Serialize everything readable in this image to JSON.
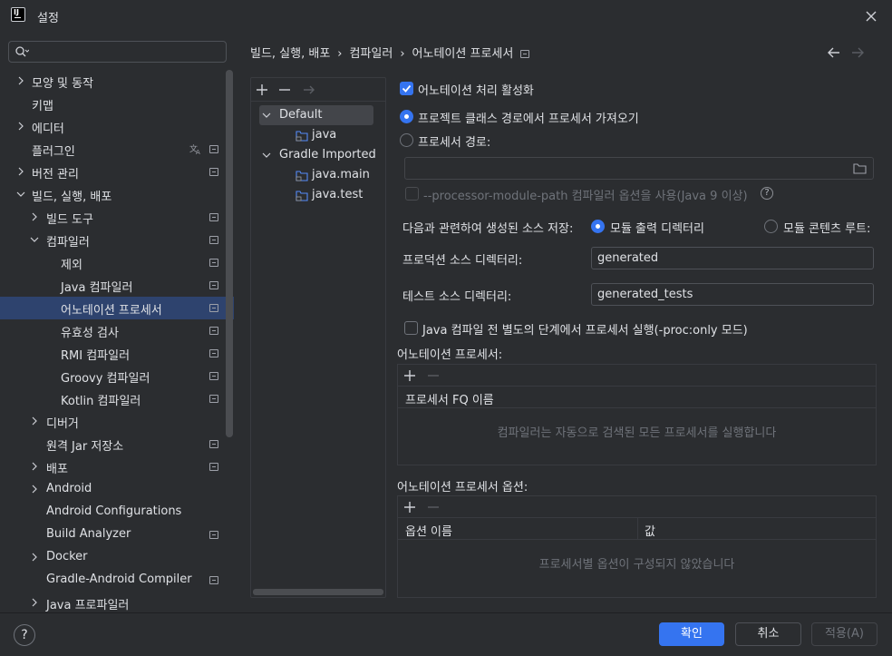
{
  "window": {
    "title": "설정",
    "logo_text": "IJ"
  },
  "search": {
    "placeholder": ""
  },
  "sidebar": {
    "items": [
      {
        "label": "모양 및 동작"
      },
      {
        "label": "키맵"
      },
      {
        "label": "에디터"
      },
      {
        "label": "플러그인"
      },
      {
        "label": "버전 관리"
      },
      {
        "label": "빌드, 실행, 배포"
      },
      {
        "label": "빌드 도구"
      },
      {
        "label": "컴파일러"
      },
      {
        "label": "제외"
      },
      {
        "label": "Java 컴파일러"
      },
      {
        "label": "어노테이션 프로세서"
      },
      {
        "label": "유효성 검사"
      },
      {
        "label": "RMI 컴파일러"
      },
      {
        "label": "Groovy 컴파일러"
      },
      {
        "label": "Kotlin 컴파일러"
      },
      {
        "label": "디버거"
      },
      {
        "label": "원격 Jar 저장소"
      },
      {
        "label": "배포"
      },
      {
        "label": "Android"
      },
      {
        "label": "Android Configurations"
      },
      {
        "label": "Build Analyzer"
      },
      {
        "label": "Docker"
      },
      {
        "label": "Gradle-Android Compiler"
      },
      {
        "label": "Java 프로파일러"
      }
    ]
  },
  "breadcrumb": {
    "items": [
      "빌드, 실행, 배포",
      "컴파일러",
      "어노테이션 프로세서"
    ]
  },
  "profiles": {
    "items": [
      {
        "label": "Default"
      },
      {
        "label": "java"
      },
      {
        "label": "Gradle Imported"
      },
      {
        "label": "java.main"
      },
      {
        "label": "java.test"
      }
    ]
  },
  "settings": {
    "enable_processing": "어노테이션 처리 활성화",
    "obtain_from_classpath": "프로젝트 클래스 경로에서 프로세서 가져오기",
    "processor_path": "프로세서 경로:",
    "processor_path_value": "",
    "module_path_option": "--processor-module-path 컴파일러 옵션을 사용(Java 9 이상)",
    "store_generated_label": "다음과 관련하여 생성된 소스 저장:",
    "module_output_dir": "모듈 출력 디렉터리",
    "module_content_root": "모듈 콘텐츠 루트:",
    "production_dir_label": "프로덕션 소스 디렉터리:",
    "production_dir_value": "generated",
    "test_dir_label": "테스트 소스 디렉터리:",
    "test_dir_value": "generated_tests",
    "proc_only": "Java 컴파일 전 별도의 단계에서 프로세서 실행(-proc:only 모드)"
  },
  "processors_table": {
    "title": "어노테이션 프로세서:",
    "column": "프로세서 FQ 이름",
    "empty_text": "컴파일러는 자동으로 검색된 모든 프로세서를 실행합니다"
  },
  "options_table": {
    "title": "어노테이션 프로세서 옵션:",
    "columns": [
      "옵션 이름",
      "값"
    ],
    "empty_text": "프로세서별 옵션이 구성되지 않았습니다"
  },
  "footer": {
    "help": "?",
    "ok": "확인",
    "cancel": "취소",
    "apply": "적용(A)"
  },
  "colors": {
    "accent": "#3574f0",
    "background": "#2b2d30",
    "selection": "#2e436e"
  }
}
